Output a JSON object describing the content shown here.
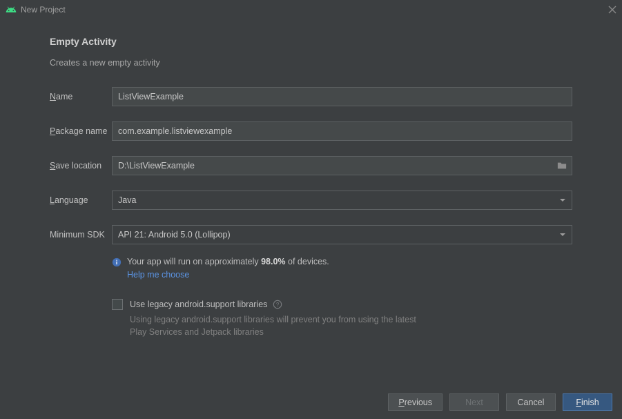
{
  "window": {
    "title": "New Project"
  },
  "heading": "Empty Activity",
  "description": "Creates a new empty activity",
  "fields": {
    "name": {
      "label_pre": "N",
      "label_post": "ame",
      "value": "ListViewExample"
    },
    "pkg": {
      "label_pre": "P",
      "label_post": "ackage name",
      "value": "com.example.listviewexample"
    },
    "save": {
      "label_pre": "S",
      "label_post": "ave location",
      "value": "D:\\ListViewExample"
    },
    "lang": {
      "label_pre": "L",
      "label_post": "anguage",
      "value": "Java"
    },
    "minsdk": {
      "label": "Minimum SDK",
      "value": "API 21: Android 5.0 (Lollipop)"
    }
  },
  "compat": {
    "prefix": "Your app will run on approximately ",
    "percent": "98.0%",
    "suffix": " of devices.",
    "help_link": "Help me choose"
  },
  "legacy": {
    "label": "Use legacy android.support libraries",
    "sub": "Using legacy android.support libraries will prevent you from using the latest Play Services and Jetpack libraries"
  },
  "buttons": {
    "previous": {
      "pre": "P",
      "post": "revious"
    },
    "next": {
      "label": "Next"
    },
    "cancel": {
      "label": "Cancel"
    },
    "finish": {
      "pre": "F",
      "post": "inish"
    }
  }
}
